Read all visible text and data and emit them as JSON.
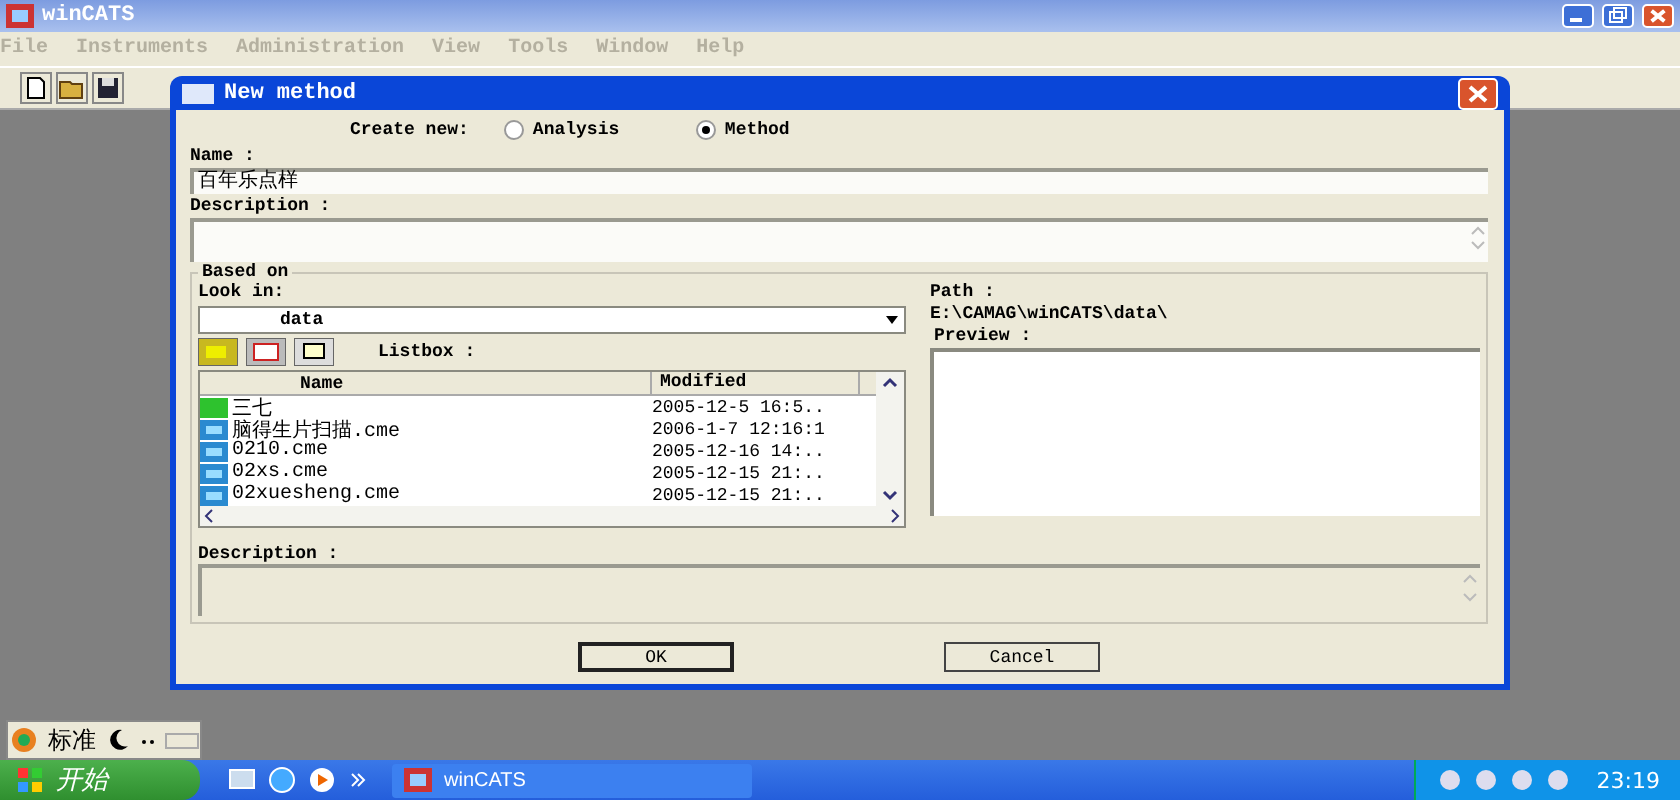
{
  "app_window": {
    "title": "winCATS",
    "menu": [
      "File",
      "Instruments",
      "Administration",
      "View",
      "Tools",
      "Window",
      "Help"
    ]
  },
  "dialog": {
    "title": "New method",
    "create_new_label": "Create new:",
    "create_options": [
      {
        "label": "Analysis",
        "selected": false
      },
      {
        "label": "Method",
        "selected": true
      }
    ],
    "name_label": "Name :",
    "name_value": "百年乐点样",
    "description_label": "Description :",
    "based_on": {
      "title": "Based on",
      "look_in_label": "Look in:",
      "look_in_value": "data",
      "path_label": "Path :",
      "path_value": "E:\\CAMAG\\winCATS\\data\\",
      "listbox_label": "Listbox :",
      "columns": [
        "Name",
        "Modified"
      ],
      "rows": [
        {
          "kind": "folder",
          "name": "三七",
          "modified": "2005-12-5 16:5.."
        },
        {
          "kind": "file",
          "name": "脑得生片扫描.cme",
          "modified": "2006-1-7 12:16:1"
        },
        {
          "kind": "file",
          "name": "0210.cme",
          "modified": "2005-12-16 14:.."
        },
        {
          "kind": "file",
          "name": "02xs.cme",
          "modified": "2005-12-15 21:.."
        },
        {
          "kind": "file",
          "name": "02xuesheng.cme",
          "modified": "2005-12-15 21:.."
        }
      ],
      "preview_label": "Preview :",
      "description_label": "Description :"
    },
    "buttons": [
      "OK",
      "Cancel"
    ]
  },
  "ime_bar": {
    "label": "标准"
  },
  "taskbar": {
    "start": "开始",
    "tasks": [
      {
        "label": "winCATS"
      }
    ],
    "clock": "23:19"
  }
}
